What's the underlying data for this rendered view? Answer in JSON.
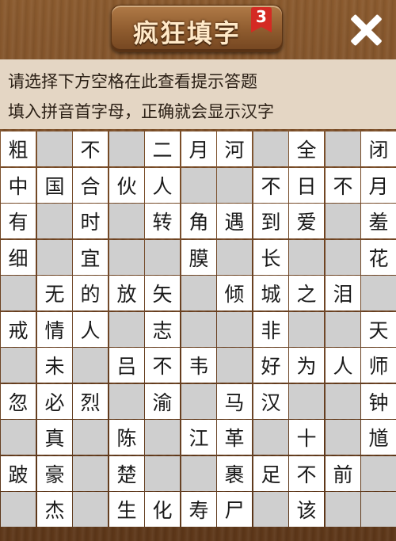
{
  "header": {
    "title": "疯狂填字",
    "level_badge": "3",
    "close_icon": "close-icon"
  },
  "hints": {
    "line1": "请选择下方空格在此查看提示答题",
    "line2": "填入拼音首字母，正确就会显示汉字"
  },
  "grid": {
    "rows": [
      [
        "粗",
        "",
        "不",
        "",
        "二",
        "月",
        "河",
        "",
        "全",
        "",
        "闭"
      ],
      [
        "中",
        "国",
        "合",
        "伙",
        "人",
        "",
        "",
        "不",
        "日",
        "不",
        "月"
      ],
      [
        "有",
        "",
        "时",
        "",
        "转",
        "角",
        "遇",
        "到",
        "爱",
        "",
        "羞"
      ],
      [
        "细",
        "",
        "宜",
        "",
        "",
        "膜",
        "",
        "长",
        "",
        "",
        "花"
      ],
      [
        "",
        "无",
        "的",
        "放",
        "矢",
        "",
        "倾",
        "城",
        "之",
        "泪",
        ""
      ],
      [
        "戒",
        "情",
        "人",
        "",
        "志",
        "",
        "",
        "非",
        "",
        "",
        "天"
      ],
      [
        "",
        "未",
        "",
        "吕",
        "不",
        "韦",
        "",
        "好",
        "为",
        "人",
        "师"
      ],
      [
        "忽",
        "必",
        "烈",
        "",
        "渝",
        "",
        "马",
        "汉",
        "",
        "",
        "钟"
      ],
      [
        "",
        "真",
        "",
        "陈",
        "",
        "江",
        "革",
        "",
        "十",
        "",
        "馗"
      ],
      [
        "跛",
        "豪",
        "",
        "楚",
        "",
        "",
        "裹",
        "足",
        "不",
        "前",
        ""
      ],
      [
        "",
        "杰",
        "",
        "生",
        "化",
        "寿",
        "尸",
        "",
        "该",
        "",
        ""
      ]
    ],
    "white_mask": [
      [
        1,
        0,
        1,
        0,
        1,
        1,
        1,
        0,
        1,
        0,
        1
      ],
      [
        1,
        1,
        1,
        1,
        1,
        0,
        0,
        1,
        1,
        1,
        1
      ],
      [
        1,
        0,
        1,
        0,
        1,
        1,
        1,
        1,
        1,
        0,
        1
      ],
      [
        1,
        0,
        1,
        0,
        0,
        1,
        0,
        1,
        0,
        0,
        1
      ],
      [
        0,
        1,
        1,
        1,
        1,
        0,
        1,
        1,
        1,
        1,
        0
      ],
      [
        1,
        1,
        1,
        0,
        1,
        0,
        0,
        1,
        0,
        0,
        1
      ],
      [
        0,
        1,
        0,
        1,
        1,
        1,
        0,
        1,
        1,
        1,
        1
      ],
      [
        1,
        1,
        1,
        0,
        1,
        0,
        1,
        1,
        0,
        0,
        1
      ],
      [
        0,
        1,
        0,
        1,
        0,
        1,
        1,
        0,
        1,
        0,
        1
      ],
      [
        1,
        1,
        0,
        1,
        0,
        0,
        1,
        1,
        1,
        1,
        0
      ],
      [
        0,
        1,
        0,
        1,
        1,
        1,
        1,
        0,
        1,
        0,
        0
      ]
    ]
  }
}
